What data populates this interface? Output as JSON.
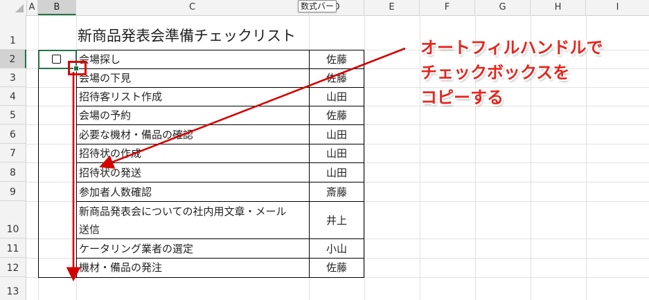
{
  "formula_bar_tooltip": "数式バー",
  "columns": [
    "A",
    "B",
    "C",
    "D",
    "E",
    "F",
    "G",
    "H",
    "I"
  ],
  "rows": [
    "1",
    "2",
    "3",
    "4",
    "5",
    "6",
    "7",
    "8",
    "9",
    "10",
    "11",
    "12",
    "13"
  ],
  "sheet": {
    "title": "新商品発表会準備チェックリスト",
    "tasks": [
      {
        "task": "会場探し",
        "person": "佐藤"
      },
      {
        "task": "会場の下見",
        "person": "佐藤"
      },
      {
        "task": "招待客リスト作成",
        "person": "山田"
      },
      {
        "task": "会場の予約",
        "person": "佐藤"
      },
      {
        "task": "必要な機材・備品の確認",
        "person": "山田"
      },
      {
        "task": "招待状の作成",
        "person": "山田"
      },
      {
        "task": "招待状の発送",
        "person": "山田"
      },
      {
        "task": "参加者人数確認",
        "person": "斎藤"
      },
      {
        "task": "新商品発表会についての社内用文章・メール",
        "task_line2": "送信",
        "person": "井上"
      },
      {
        "task": "ケータリング業者の選定",
        "person": "小山"
      },
      {
        "task": "機材・備品の発注",
        "person": "佐藤"
      }
    ]
  },
  "annotation": {
    "lines": [
      "オートフィルハンドルで",
      "チェックボックスを",
      "コピーする"
    ],
    "color": "#e6251e"
  },
  "colors": {
    "selection": "#217346",
    "arrow": "#d40000"
  }
}
